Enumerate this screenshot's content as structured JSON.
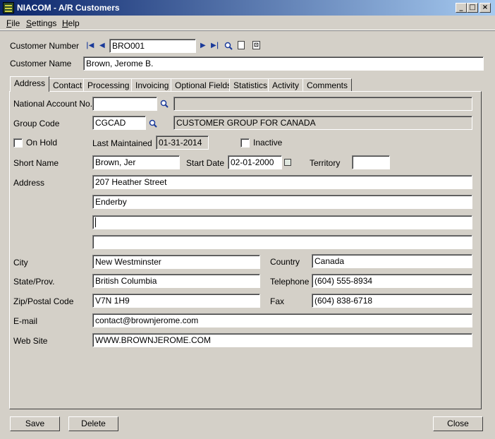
{
  "window": {
    "title": "NIACOM - A/R Customers",
    "min": "_",
    "max": "□",
    "close": "×"
  },
  "menu": [
    {
      "label": "File",
      "accel": "F",
      "rest": "ile"
    },
    {
      "label": "Settings",
      "accel": "S",
      "rest": "ettings"
    },
    {
      "label": "Help",
      "accel": "H",
      "rest": "elp"
    }
  ],
  "header": {
    "customer_number_label": "Customer Number",
    "customer_number": "BRO001",
    "customer_name_label": "Customer Name",
    "customer_name": "Brown, Jerome B."
  },
  "tabs": [
    "Address",
    "Contact",
    "Processing",
    "Invoicing",
    "Optional Fields",
    "Statistics",
    "Activity",
    "Comments"
  ],
  "address": {
    "national_account_label": "National Account No.",
    "national_account": "",
    "national_account_desc": "",
    "group_code_label": "Group Code",
    "group_code": "CGCAD",
    "group_desc": "CUSTOMER GROUP FOR CANADA",
    "on_hold_label": "On Hold",
    "last_maintained_label": "Last Maintained",
    "last_maintained": "01-31-2014",
    "inactive_label": "Inactive",
    "short_name_label": "Short Name",
    "short_name": "Brown, Jer",
    "start_date_label": "Start Date",
    "start_date": "02-01-2000",
    "territory_label": "Territory",
    "territory": "",
    "address_label": "Address",
    "address_lines": [
      "207 Heather Street",
      "Enderby",
      "",
      ""
    ],
    "city_label": "City",
    "city": "New Westminster",
    "country_label": "Country",
    "country": "Canada",
    "state_label": "State/Prov.",
    "state": "British Columbia",
    "telephone_label": "Telephone",
    "telephone": "(604) 555-8934",
    "zip_label": "Zip/Postal Code",
    "zip": "V7N 1H9",
    "fax_label": "Fax",
    "fax": "(604) 838-6718",
    "email_label": "E-mail",
    "email": "contact@brownjerome.com",
    "website_label": "Web Site",
    "website": "WWW.BROWNJEROME.COM"
  },
  "buttons": {
    "save": "Save",
    "delete": "Delete",
    "close": "Close"
  }
}
